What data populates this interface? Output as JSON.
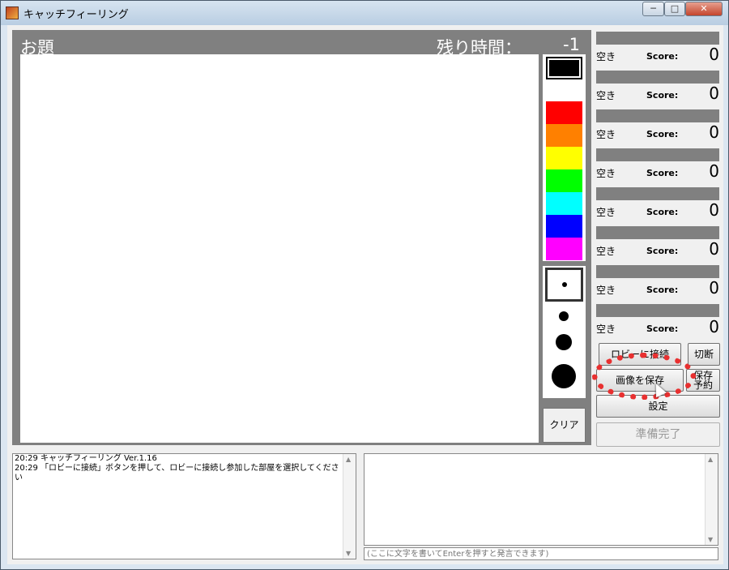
{
  "window": {
    "title": "キャッチフィーリング",
    "min_label": "─",
    "max_label": "□",
    "close_label": "✕"
  },
  "game": {
    "topic_label": "お題",
    "remaining_label": "残り時間：",
    "timer_value": "-1"
  },
  "palette": {
    "colors": [
      "#000000",
      "#ffffff",
      "#ff0000",
      "#ff8000",
      "#ffff00",
      "#00ff00",
      "#00ffff",
      "#0000ff",
      "#ff00ff"
    ],
    "selected_index": 0
  },
  "brushes": [
    "small",
    "medium",
    "large",
    "x-large"
  ],
  "clear_label": "クリア",
  "players": [
    {
      "state": "空き",
      "score_label": "Score:",
      "score": "0"
    },
    {
      "state": "空き",
      "score_label": "Score:",
      "score": "0"
    },
    {
      "state": "空き",
      "score_label": "Score:",
      "score": "0"
    },
    {
      "state": "空き",
      "score_label": "Score:",
      "score": "0"
    },
    {
      "state": "空き",
      "score_label": "Score:",
      "score": "0"
    },
    {
      "state": "空き",
      "score_label": "Score:",
      "score": "0"
    },
    {
      "state": "空き",
      "score_label": "Score:",
      "score": "0"
    },
    {
      "state": "空き",
      "score_label": "Score:",
      "score": "0"
    }
  ],
  "buttons": {
    "connect_lobby": "ロビーに接続",
    "disconnect": "切断",
    "save_image": "画像を保存",
    "reserve_save_line1": "保存",
    "reserve_save_line2": "予約",
    "settings": "設定",
    "ready": "準備完了"
  },
  "log": [
    "20:29 キャッチフィーリング Ver.1.16",
    "20:29 「ロビーに接続」ボタンを押して、ロビーに接続し参加した部屋を選択してください"
  ],
  "chat_input": {
    "placeholder": "(ここに文字を書いてEnterを押すと発言できます)"
  }
}
